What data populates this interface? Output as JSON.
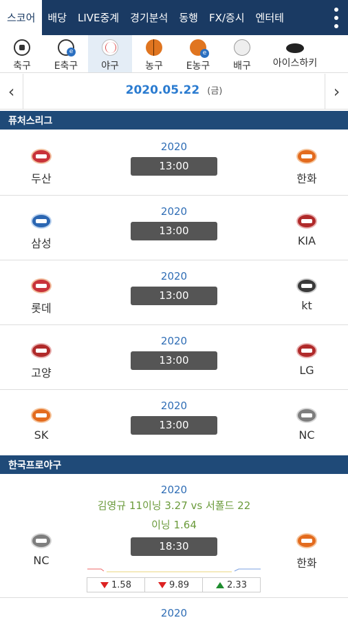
{
  "topnav": {
    "tabs": [
      "스코어",
      "배당",
      "LIVE중계",
      "경기분석",
      "동행",
      "FX/증시",
      "엔터테"
    ]
  },
  "sports": [
    {
      "label": "축구",
      "icon": "soccer-ball-icon"
    },
    {
      "label": "E축구",
      "icon": "e-soccer-icon"
    },
    {
      "label": "야구",
      "icon": "baseball-icon"
    },
    {
      "label": "농구",
      "icon": "basketball-icon"
    },
    {
      "label": "E농구",
      "icon": "e-basketball-icon"
    },
    {
      "label": "배구",
      "icon": "volleyball-icon"
    },
    {
      "label": "아이스하키",
      "icon": "hockey-puck-icon"
    }
  ],
  "datebar": {
    "date": "2020.05.22",
    "weekday": "(금)"
  },
  "leagues": [
    {
      "name": "퓨처스리그",
      "games": [
        {
          "home": "두산",
          "away": "한화",
          "season": "2020",
          "time": "13:00"
        },
        {
          "home": "삼성",
          "away": "KIA",
          "season": "2020",
          "time": "13:00"
        },
        {
          "home": "롯데",
          "away": "kt",
          "season": "2020",
          "time": "13:00"
        },
        {
          "home": "고양",
          "away": "LG",
          "season": "2020",
          "time": "13:00"
        },
        {
          "home": "SK",
          "away": "NC",
          "season": "2020",
          "time": "13:00"
        }
      ]
    },
    {
      "name": "한국프로야구",
      "games": [
        {
          "home": "NC",
          "away": "한화",
          "season": "2020",
          "time": "18:30",
          "pitchers_line1": "김영규 11이닝 3.27 vs 서폴드 22",
          "pitchers_line2": "이닝 1.64",
          "odds": [
            {
              "dir": "down",
              "value": "1.58"
            },
            {
              "dir": "down",
              "value": "9.89"
            },
            {
              "dir": "up",
              "value": "2.33"
            }
          ]
        },
        {
          "season": "2020"
        }
      ]
    }
  ],
  "colors": {
    "nav": "#1a3a63",
    "league": "#1f4a78",
    "date": "#2a7bd0",
    "season": "#2f6db5",
    "pitchers": "#6a9a3a",
    "down": "#d22222",
    "up": "#1e8c2e"
  }
}
